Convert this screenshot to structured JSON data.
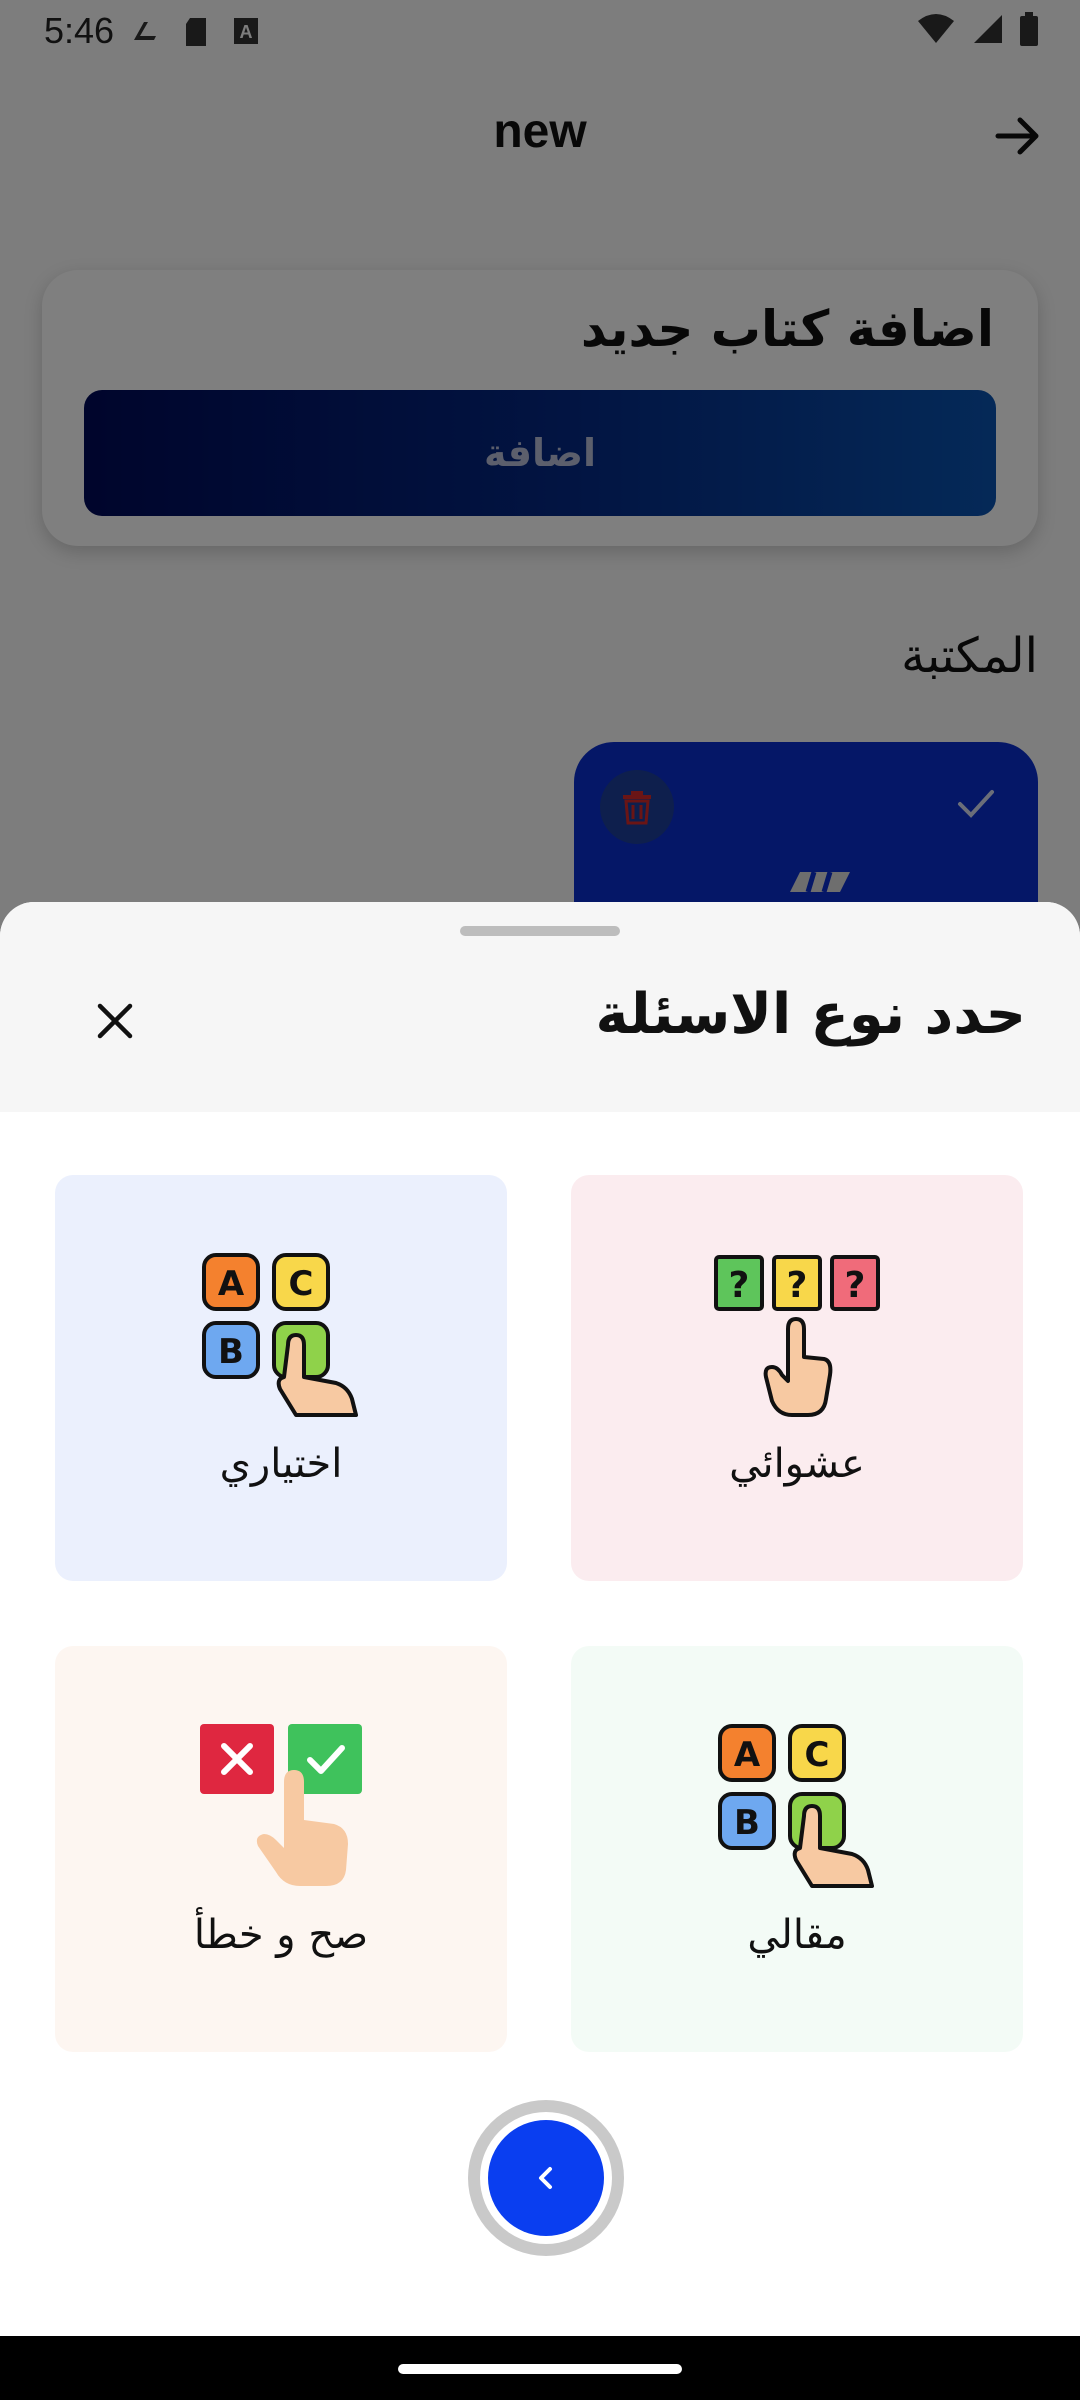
{
  "status_bar": {
    "time": "5:46"
  },
  "app_bar": {
    "title": "new"
  },
  "add_book_card": {
    "title": "اضافة كتاب جديد",
    "button_label": "اضافة"
  },
  "library": {
    "title": "المكتبة"
  },
  "sheet": {
    "title": "حدد نوع الاسئلة",
    "options": [
      {
        "label": "عشوائي",
        "icon": "random-questions-icon",
        "bg": "#fbecef"
      },
      {
        "label": "اختياري",
        "icon": "multiple-choice-icon",
        "bg": "#ebf0fd"
      },
      {
        "label": "مقالي",
        "icon": "essay-icon",
        "bg": "#f3fbf6"
      },
      {
        "label": "صح و خطأ",
        "icon": "true-false-icon",
        "bg": "#fdf6f1"
      }
    ]
  },
  "colors": {
    "accent": "#0a3ef0",
    "primary_gradient_start": "#000a58",
    "primary_gradient_end": "#0a53b0",
    "book_card": "#0a2ecf"
  }
}
